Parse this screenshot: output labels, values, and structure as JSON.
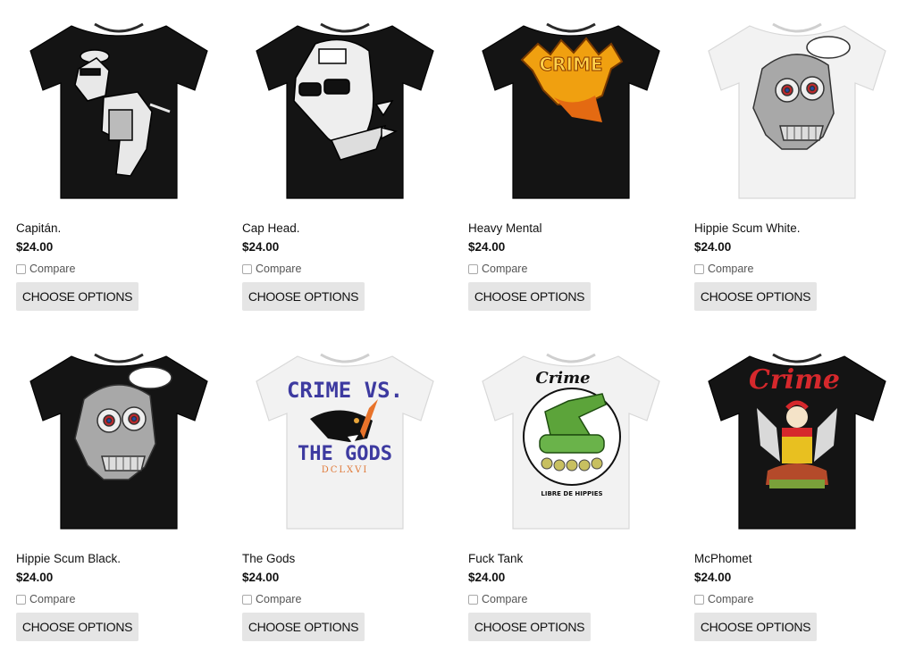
{
  "colors": {
    "button_bg": "#e5e5e5",
    "black_shirt": "#141414",
    "white_shirt": "#f2f2f2"
  },
  "products": [
    {
      "title": "Capitán.",
      "price": "$24.00",
      "compare_label": "Compare",
      "button_label": "CHOOSE OPTIONS",
      "shirt_color": "black",
      "graphic": "dog-captain-icon"
    },
    {
      "title": "Cap Head.",
      "price": "$24.00",
      "compare_label": "Compare",
      "button_label": "CHOOSE OPTIONS",
      "shirt_color": "black",
      "graphic": "dog-head-icon"
    },
    {
      "title": "Heavy Mental",
      "price": "$24.00",
      "compare_label": "Compare",
      "button_label": "CHOOSE OPTIONS",
      "shirt_color": "black",
      "graphic": "flame-logo-icon"
    },
    {
      "title": "Hippie Scum White.",
      "price": "$24.00",
      "compare_label": "Compare",
      "button_label": "CHOOSE OPTIONS",
      "shirt_color": "white",
      "graphic": "skull-icon"
    },
    {
      "title": "Hippie Scum Black.",
      "price": "$24.00",
      "compare_label": "Compare",
      "button_label": "CHOOSE OPTIONS",
      "shirt_color": "black",
      "graphic": "skull-icon"
    },
    {
      "title": "The Gods",
      "price": "$24.00",
      "compare_label": "Compare",
      "button_label": "CHOOSE OPTIONS",
      "shirt_color": "white",
      "graphic": "panther-icon",
      "print_top": "CRIME VS.",
      "print_bottom": "THE GODS",
      "print_numeral": "DCLXVI"
    },
    {
      "title": "Fuck Tank",
      "price": "$24.00",
      "compare_label": "Compare",
      "button_label": "CHOOSE OPTIONS",
      "shirt_color": "white",
      "graphic": "tank-icon",
      "print_top": "Crime",
      "print_bottom": "LIBRE DE HIPPIES"
    },
    {
      "title": "McPhomet",
      "price": "$24.00",
      "compare_label": "Compare",
      "button_label": "CHOOSE OPTIONS",
      "shirt_color": "black",
      "graphic": "clown-icon",
      "print_top": "Crime"
    }
  ]
}
